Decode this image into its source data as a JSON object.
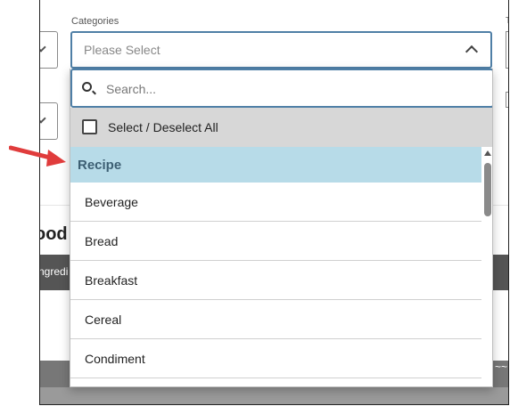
{
  "background": {
    "heading_partial": "ood",
    "dark_bar_partial": "ngredi",
    "tilde": "~~",
    "right_label_partial": "T"
  },
  "field": {
    "label": "Categories",
    "placeholder": "Please Select"
  },
  "dropdown": {
    "search_placeholder": "Search...",
    "select_all_label": "Select / Deselect All",
    "group_header": "Recipe",
    "options": [
      "Beverage",
      "Bread",
      "Breakfast",
      "Cereal",
      "Condiment"
    ]
  },
  "colors": {
    "accent_border": "#4f7fa6",
    "group_header_bg": "#b7dbe8",
    "annotation_arrow": "#e03c3c"
  },
  "icons": {
    "search": "search-icon",
    "chevron": "chevron-up-icon",
    "arrow": "red-arrow-annotation"
  }
}
